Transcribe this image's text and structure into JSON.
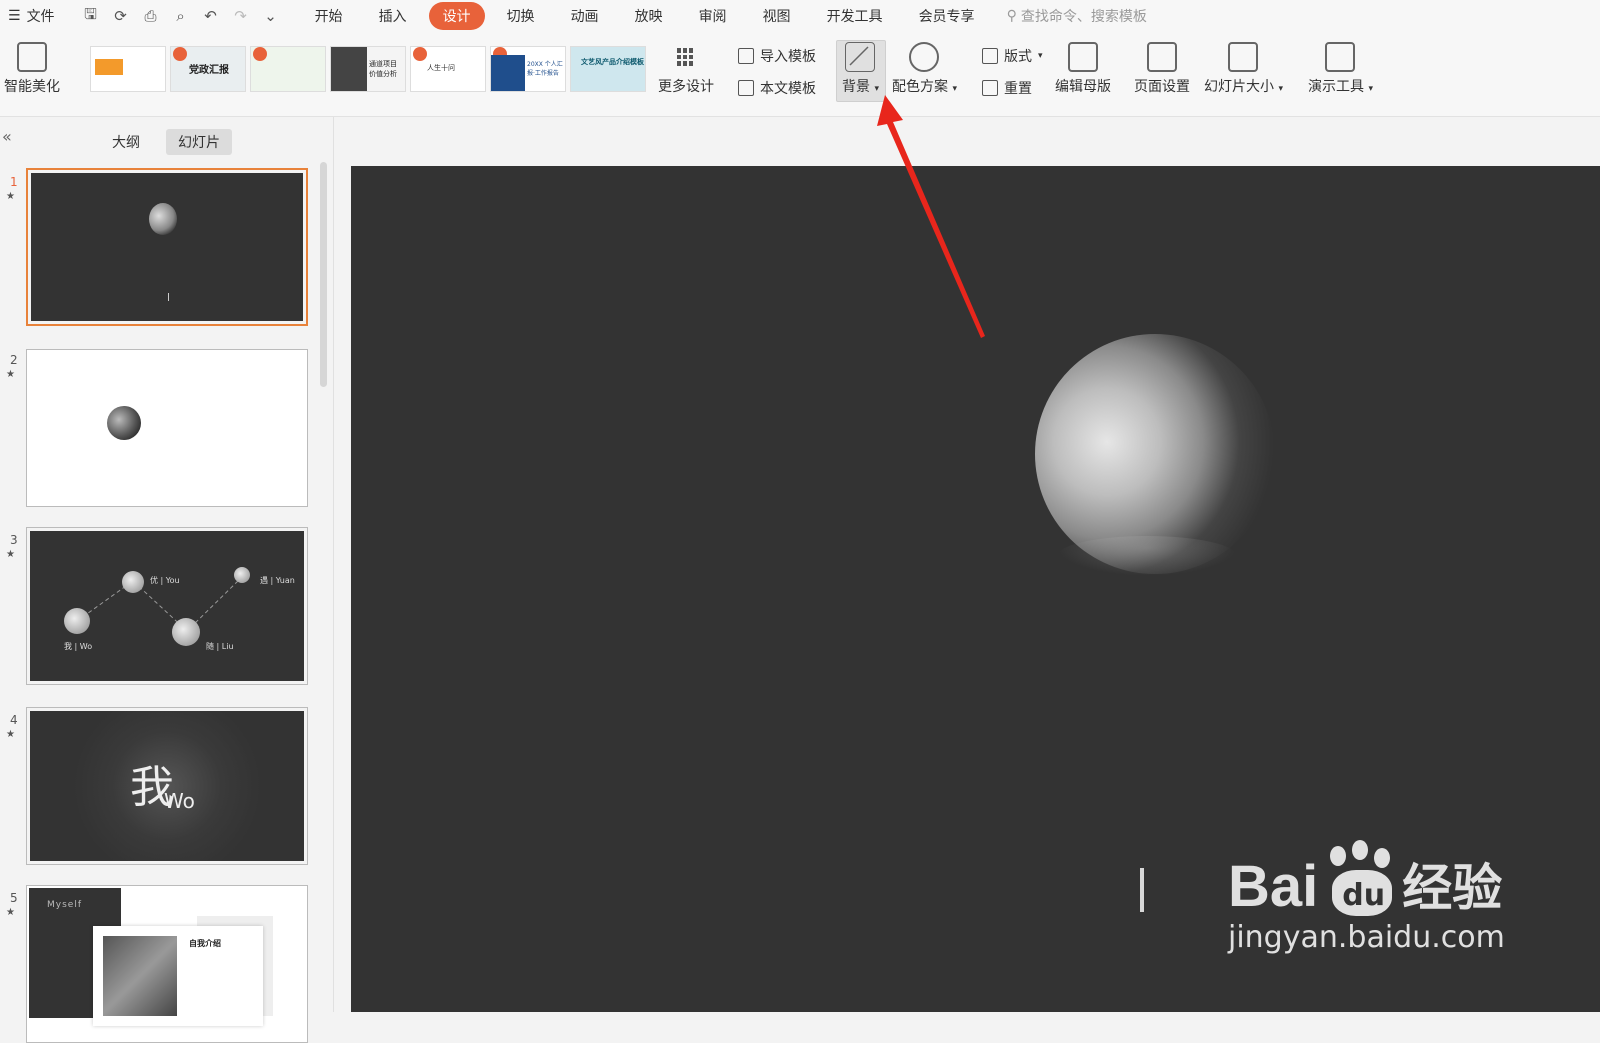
{
  "menubar": {
    "file_label": "文件",
    "tabs": [
      "开始",
      "插入",
      "设计",
      "切换",
      "动画",
      "放映",
      "审阅",
      "视图",
      "开发工具",
      "会员专享"
    ],
    "active_tab": "设计",
    "search_placeholder": "查找命令、搜索模板"
  },
  "ribbon": {
    "smart_beautify": "智能美化",
    "more_design": "更多设计",
    "import_template": "导入模板",
    "text_template": "本文模板",
    "background": "背景",
    "color_scheme": "配色方案",
    "layout": "版式",
    "reset": "重置",
    "edit_master": "编辑母版",
    "page_setup": "页面设置",
    "slide_size": "幻灯片大小",
    "present_tools": "演示工具",
    "gallery": [
      {
        "label": ""
      },
      {
        "label": "党政汇报"
      },
      {
        "label": ""
      },
      {
        "label": "通道项目 价值分析"
      },
      {
        "label": "人生十问"
      },
      {
        "label": "20XX 个人汇报·工作报告"
      },
      {
        "label": "文艺风产品介绍模板"
      }
    ]
  },
  "leftpane": {
    "tab_outline": "大纲",
    "tab_slides": "幻灯片",
    "slides": [
      {
        "num": "1",
        "star": "★"
      },
      {
        "num": "2",
        "star": "★"
      },
      {
        "num": "3",
        "star": "★",
        "labels": [
          "优 | You",
          "遇 | Yuan",
          "我 | Wo",
          "随 | Liu"
        ]
      },
      {
        "num": "4",
        "star": "★",
        "text_big": "我",
        "text_small": "Wo"
      },
      {
        "num": "5",
        "star": "★",
        "myself": "Myself",
        "intro_title": "自我介绍"
      }
    ]
  },
  "watermark": {
    "brand": "Bai",
    "brand2": "du",
    "cn": "经验",
    "url": "jingyan.baidu.com"
  },
  "colors": {
    "accent": "#e8623a",
    "canvas": "#333333",
    "arrow": "#e8261c"
  }
}
